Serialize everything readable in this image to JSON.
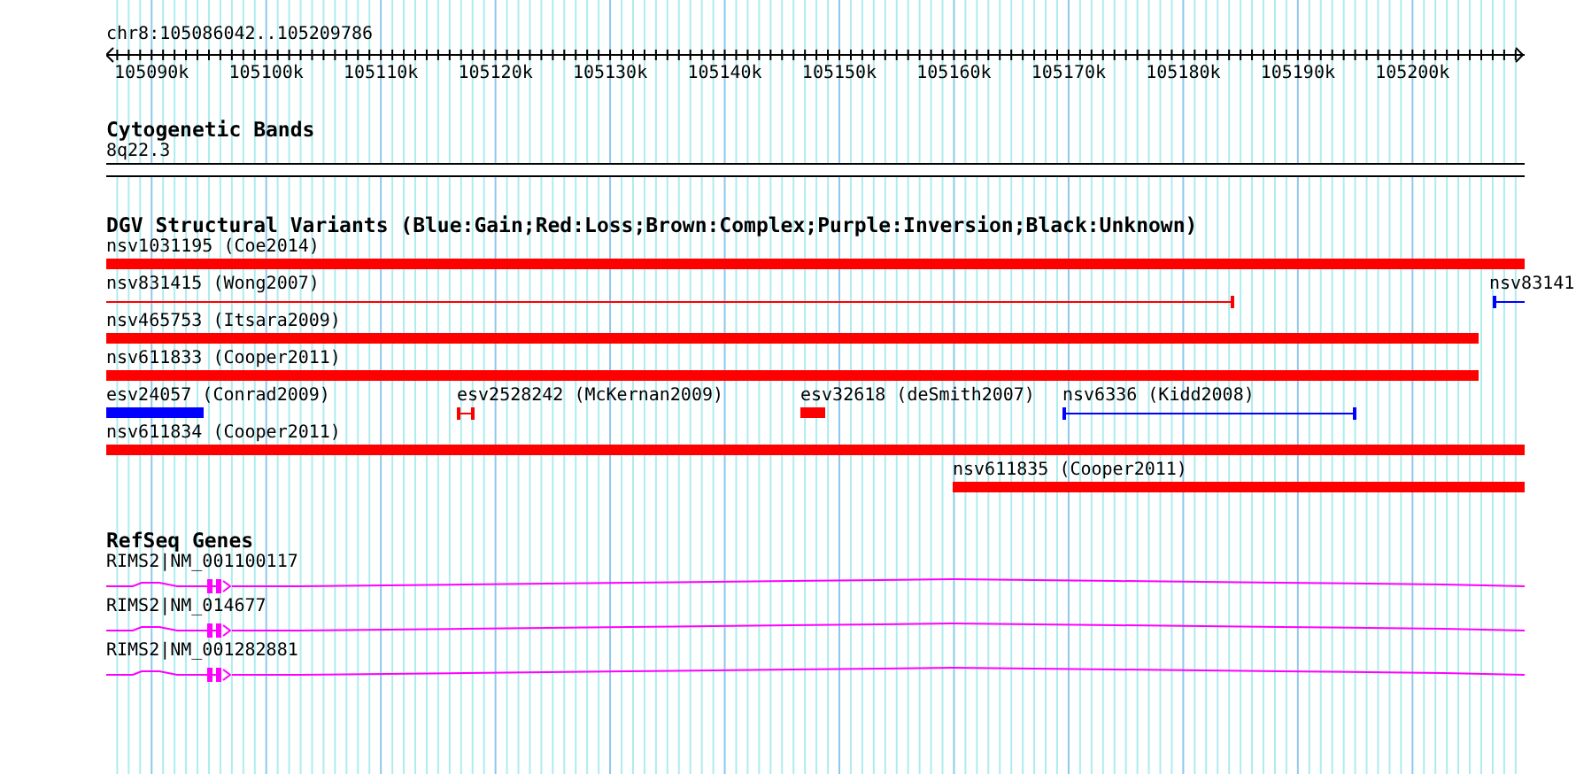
{
  "location": "chr8:105086042..105209786",
  "ruler_ticks": [
    "105090k",
    "105100k",
    "105110k",
    "105120k",
    "105130k",
    "105140k",
    "105150k",
    "105160k",
    "105170k",
    "105180k",
    "105190k",
    "105200k"
  ],
  "cytogenetic_bands": {
    "title": "Cytogenetic Bands",
    "band": "8q22.3"
  },
  "dgv_variants": {
    "title": "DGV Structural Variants (Blue:Gain;Red:Loss;Brown:Complex;Purple:Inversion;Black:Unknown)",
    "rows": [
      {
        "features": [
          {
            "label": "nsv1031195 (Coe2014)",
            "color": "#ff0000",
            "kind": "bar"
          }
        ]
      },
      {
        "features": [
          {
            "label": "nsv831415 (Wong2007)",
            "color": "#ff0000",
            "kind": "line"
          },
          {
            "label": "nsv83141",
            "color": "#0000ff",
            "kind": "line"
          }
        ]
      },
      {
        "features": [
          {
            "label": "nsv465753 (Itsara2009)",
            "color": "#ff0000",
            "kind": "bar"
          }
        ]
      },
      {
        "features": [
          {
            "label": "nsv611833 (Cooper2011)",
            "color": "#ff0000",
            "kind": "bar"
          }
        ]
      },
      {
        "features": [
          {
            "label": "esv24057 (Conrad2009)",
            "color": "#0000ff",
            "kind": "bar"
          },
          {
            "label": "esv2528242 (McKernan2009)",
            "color": "#ff0000",
            "kind": "line"
          },
          {
            "label": "esv32618 (deSmith2007)",
            "color": "#ff0000",
            "kind": "bar"
          },
          {
            "label": "nsv6336 (Kidd2008)",
            "color": "#0000ff",
            "kind": "line"
          }
        ]
      },
      {
        "features": [
          {
            "label": "nsv611834 (Cooper2011)",
            "color": "#ff0000",
            "kind": "bar"
          }
        ]
      },
      {
        "features": [
          {
            "label": "nsv611835 (Cooper2011)",
            "color": "#ff0000",
            "kind": "bar"
          }
        ]
      }
    ]
  },
  "refseq_genes": {
    "title": "RefSeq Genes",
    "genes": [
      {
        "label": "RIMS2|NM_001100117"
      },
      {
        "label": "RIMS2|NM_014677"
      },
      {
        "label": "RIMS2|NM_001282881"
      }
    ]
  }
}
